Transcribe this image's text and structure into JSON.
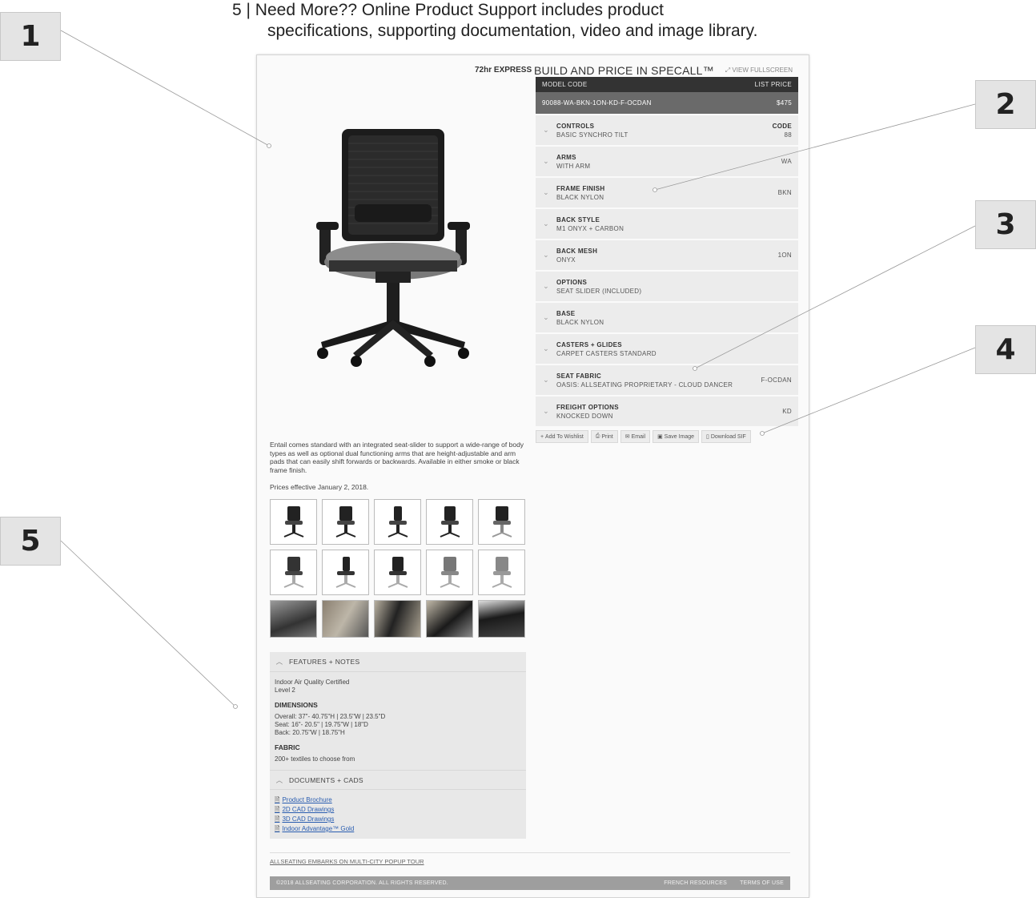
{
  "callouts": [
    "1",
    "2",
    "3",
    "4",
    "5"
  ],
  "caption": {
    "line1": "5 | Need More?? Online Product Support includes product",
    "line2": "specifications, supporting documentation, video and image library."
  },
  "header": {
    "express": "72hr EXPRESS",
    "title": "BUILD AND PRICE IN SPECALL™",
    "fullscreen": "VIEW FULLSCREEN"
  },
  "config": {
    "model_code_label": "MODEL CODE",
    "list_price_label": "LIST PRICE",
    "model_code": "90088-WA-BKN-1ON-KD-F-OCDAN",
    "list_price": "$475",
    "rows": [
      {
        "title": "CONTROLS",
        "value": "BASIC SYNCHRO TILT",
        "code_label": "CODE",
        "code": "88"
      },
      {
        "title": "ARMS",
        "value": "WITH ARM",
        "code_label": "",
        "code": "WA"
      },
      {
        "title": "FRAME FINISH",
        "value": "BLACK NYLON",
        "code_label": "",
        "code": "BKN"
      },
      {
        "title": "BACK STYLE",
        "value": "M1 ONYX + CARBON",
        "code_label": "",
        "code": ""
      },
      {
        "title": "BACK MESH",
        "value": "ONYX",
        "code_label": "",
        "code": "1ON"
      },
      {
        "title": "OPTIONS",
        "value": "SEAT SLIDER (INCLUDED)",
        "code_label": "",
        "code": ""
      },
      {
        "title": "BASE",
        "value": "BLACK NYLON",
        "code_label": "",
        "code": ""
      },
      {
        "title": "CASTERS + GLIDES",
        "value": "CARPET CASTERS STANDARD",
        "code_label": "",
        "code": ""
      },
      {
        "title": "SEAT FABRIC",
        "value": "OASIS: ALLSEATING PROPRIETARY - CLOUD DANCER",
        "code_label": "",
        "code": "F-OCDAN"
      },
      {
        "title": "FREIGHT OPTIONS",
        "value": "KNOCKED DOWN",
        "code_label": "",
        "code": "KD"
      }
    ]
  },
  "actions": [
    {
      "icon": "+",
      "label": "Add To Wishlist"
    },
    {
      "icon": "⎙",
      "label": "Print"
    },
    {
      "icon": "✉",
      "label": "Email"
    },
    {
      "icon": "▣",
      "label": "Save Image"
    },
    {
      "icon": "▯",
      "label": "Download SIF"
    }
  ],
  "description": "Entail comes standard with an integrated seat-slider to support a wide-range of body types as well as optional dual functioning arms that are height-adjustable and arm pads that can easily shift forwards or backwards. Available in either smoke or black frame finish.",
  "prices_effective": "Prices effective January 2, 2018.",
  "features": {
    "header": "FEATURES + NOTES",
    "cert_line1": "Indoor Air Quality Certified",
    "cert_line2": "Level 2",
    "dimensions_label": "DIMENSIONS",
    "dim_overall": "Overall: 37\"- 40.75\"H | 23.5\"W | 23.5\"D",
    "dim_seat": "Seat: 16\"- 20.5\" | 19.75\"W | 18\"D",
    "dim_back": "Back: 20.75\"W | 18.75\"H",
    "fabric_label": "FABRIC",
    "fabric_text": "200+ textiles to choose from"
  },
  "documents": {
    "header": "DOCUMENTS + CADS",
    "links": [
      "Product Brochure",
      "2D CAD Drawings",
      "3D CAD Drawings",
      "Indoor Advantage™ Gold"
    ]
  },
  "news": "ALLSEATING EMBARKS ON MULTI-CITY POPUP TOUR",
  "footer": {
    "copyright": "©2018 ALLSEATING CORPORATION. ALL RIGHTS RESERVED.",
    "link1": "FRENCH RESOURCES",
    "link2": "TERMS OF USE"
  }
}
